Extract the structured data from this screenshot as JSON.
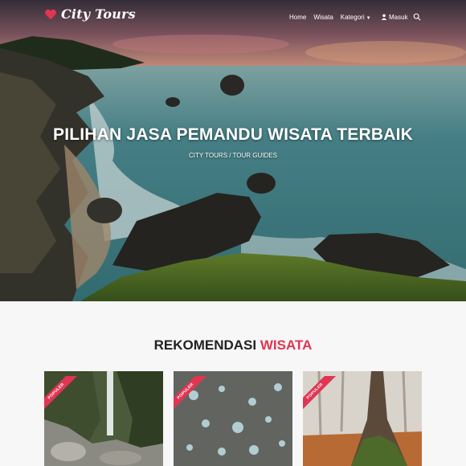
{
  "brand": {
    "name": "City Tours",
    "accent": "#e03553"
  },
  "nav": {
    "links": [
      "Home",
      "Wisata",
      "Kategori"
    ],
    "login": "Masuk"
  },
  "hero": {
    "title": "PILIHAN JASA PEMANDU WISATA TERBAIK",
    "subtitle": "CITY TOURS / TOUR GUIDES"
  },
  "section": {
    "title_main": "REKOMENDASI",
    "title_accent": "WISATA"
  },
  "cards": [
    {
      "badge": "POPULER"
    },
    {
      "badge": "POPULER"
    },
    {
      "badge": "POPULER"
    }
  ]
}
